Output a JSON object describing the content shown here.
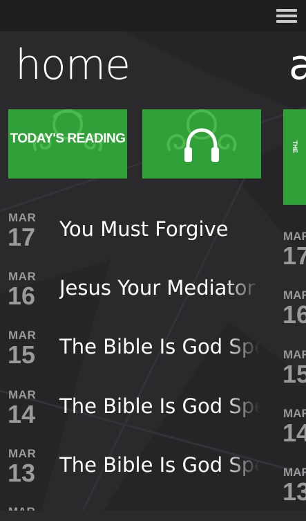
{
  "colors": {
    "background": "#2a2a2d",
    "topbar": "#1f1f21",
    "tile_green": "#30a038",
    "date_gray": "#9a9a9c",
    "text": "#ffffff"
  },
  "app_bar": {
    "menu_icon": "hamburger-icon"
  },
  "panorama": {
    "title": "home",
    "next_title": "a"
  },
  "tiles": [
    {
      "label": "TODAY'S READING",
      "icon": "swirl-decoration"
    },
    {
      "label": "",
      "icon": "headphones-icon"
    },
    {
      "label": "THE",
      "icon": "swirl-decoration"
    }
  ],
  "readings": [
    {
      "month": "MAR",
      "day": "17",
      "title": "You Must Forgive"
    },
    {
      "month": "MAR",
      "day": "16",
      "title": "Jesus Your Mediator"
    },
    {
      "month": "MAR",
      "day": "15",
      "title": "The Bible Is God Speaking"
    },
    {
      "month": "MAR",
      "day": "14",
      "title": "The Bible Is God Speaking"
    },
    {
      "month": "MAR",
      "day": "13",
      "title": "The Bible Is God Speaking"
    }
  ],
  "next_readings": [
    {
      "month": "MAR",
      "day": "17"
    },
    {
      "month": "MAR",
      "day": "16"
    },
    {
      "month": "MAR",
      "day": "15"
    },
    {
      "month": "MAR",
      "day": "14"
    },
    {
      "month": "MAR",
      "day": "13"
    }
  ],
  "bottom_partial_month": "MAR"
}
